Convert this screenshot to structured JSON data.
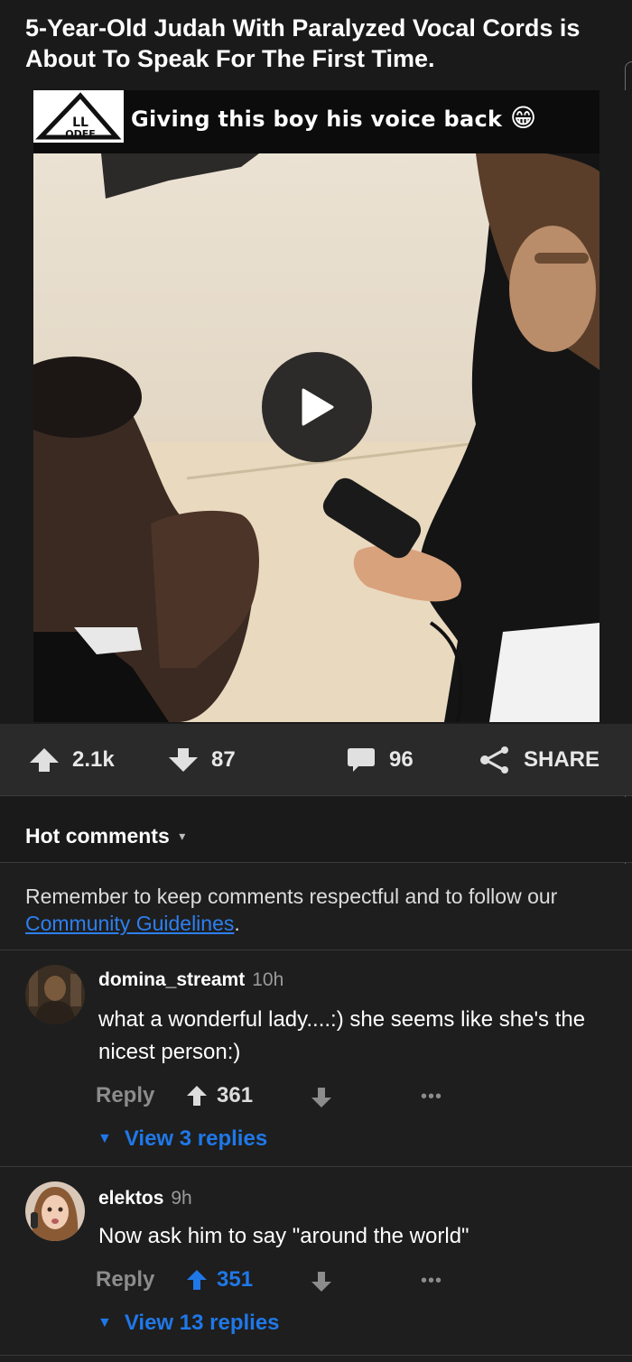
{
  "post": {
    "title": "5-Year-Old Judah With Paralyzed Vocal Cords is About To Speak For The First Time.",
    "caption": "Giving this boy his voice back",
    "caption_emoji": "😁"
  },
  "actions": {
    "upvotes": "2.1k",
    "downvotes": "87",
    "comments": "96",
    "share": "SHARE"
  },
  "comments_header": {
    "label": "Hot comments",
    "caret": "▾"
  },
  "notice": {
    "text_before": "Remember to keep comments respectful and to follow our ",
    "link": "Community Guidelines",
    "text_after": "."
  },
  "comments": [
    {
      "author": "domina_streamt",
      "time": "10h",
      "text": "what a wonderful lady....:) she seems like she's the nicest person:)",
      "reply_label": "Reply",
      "score": "361",
      "score_color": "#dcdcdc",
      "more": "•••",
      "view_replies": "View 3 replies"
    },
    {
      "author": "elektos",
      "time": "9h",
      "text": "Now ask him to say \"around the world\"",
      "reply_label": "Reply",
      "score": "351",
      "score_color": "#1f78e8",
      "more": "•••",
      "view_replies": "View 13 replies"
    }
  ],
  "colors": {
    "background": "#1e1e1e",
    "link_blue": "#2d7ff0",
    "accent_blue": "#1f78e8",
    "muted": "#8c8c8c"
  },
  "icons": [
    "upvote-arrow-icon",
    "downvote-arrow-icon",
    "comment-bubble-icon",
    "share-icon",
    "play-icon",
    "caret-down-icon",
    "more-dots-icon"
  ]
}
